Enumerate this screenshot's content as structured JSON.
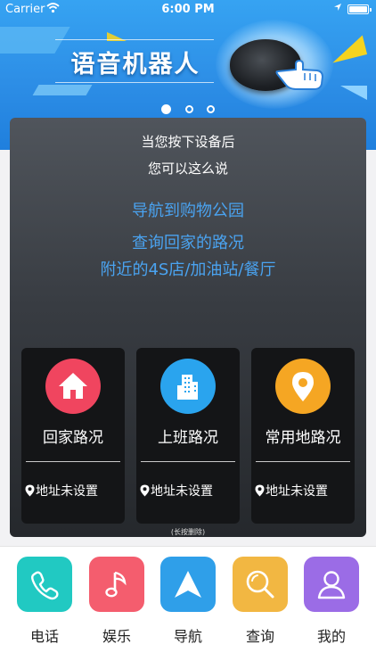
{
  "status_bar": {
    "carrier": "Carrier",
    "time": "6:00 PM"
  },
  "banner": {
    "title": "语音机器人",
    "page_count": 3,
    "active_page": 1,
    "colors": {
      "background": "#2d8ee6",
      "accent": "#f5d31f"
    }
  },
  "panel": {
    "hint_line1": "当您按下设备后",
    "hint_line2": "您可以这么说",
    "examples": [
      "导航到购物公园",
      "查询回家的路况",
      "附近的4S店/加油站/餐厅"
    ],
    "example_color": "#4aa3f0",
    "cards": [
      {
        "icon": "home-icon",
        "label": "回家路况",
        "address": "地址未设置",
        "color": "#f0455f"
      },
      {
        "icon": "office-building-icon",
        "label": "上班路况",
        "address": "地址未设置",
        "color": "#2aa4ee"
      },
      {
        "icon": "location-pin-icon",
        "label": "常用地路况",
        "address": "地址未设置",
        "color": "#f5a623"
      }
    ],
    "note": "(长按删除)"
  },
  "tabbar": {
    "tabs": [
      {
        "label": "电话",
        "icon": "phone-icon",
        "color": "#21c9c2"
      },
      {
        "label": "娱乐",
        "icon": "music-note-icon",
        "color": "#f45d6e"
      },
      {
        "label": "导航",
        "icon": "navigation-arrow-icon",
        "color": "#2f9fe9"
      },
      {
        "label": "查询",
        "icon": "search-icon",
        "color": "#f2b742"
      },
      {
        "label": "我的",
        "icon": "user-icon",
        "color": "#9b6ce6"
      }
    ]
  }
}
